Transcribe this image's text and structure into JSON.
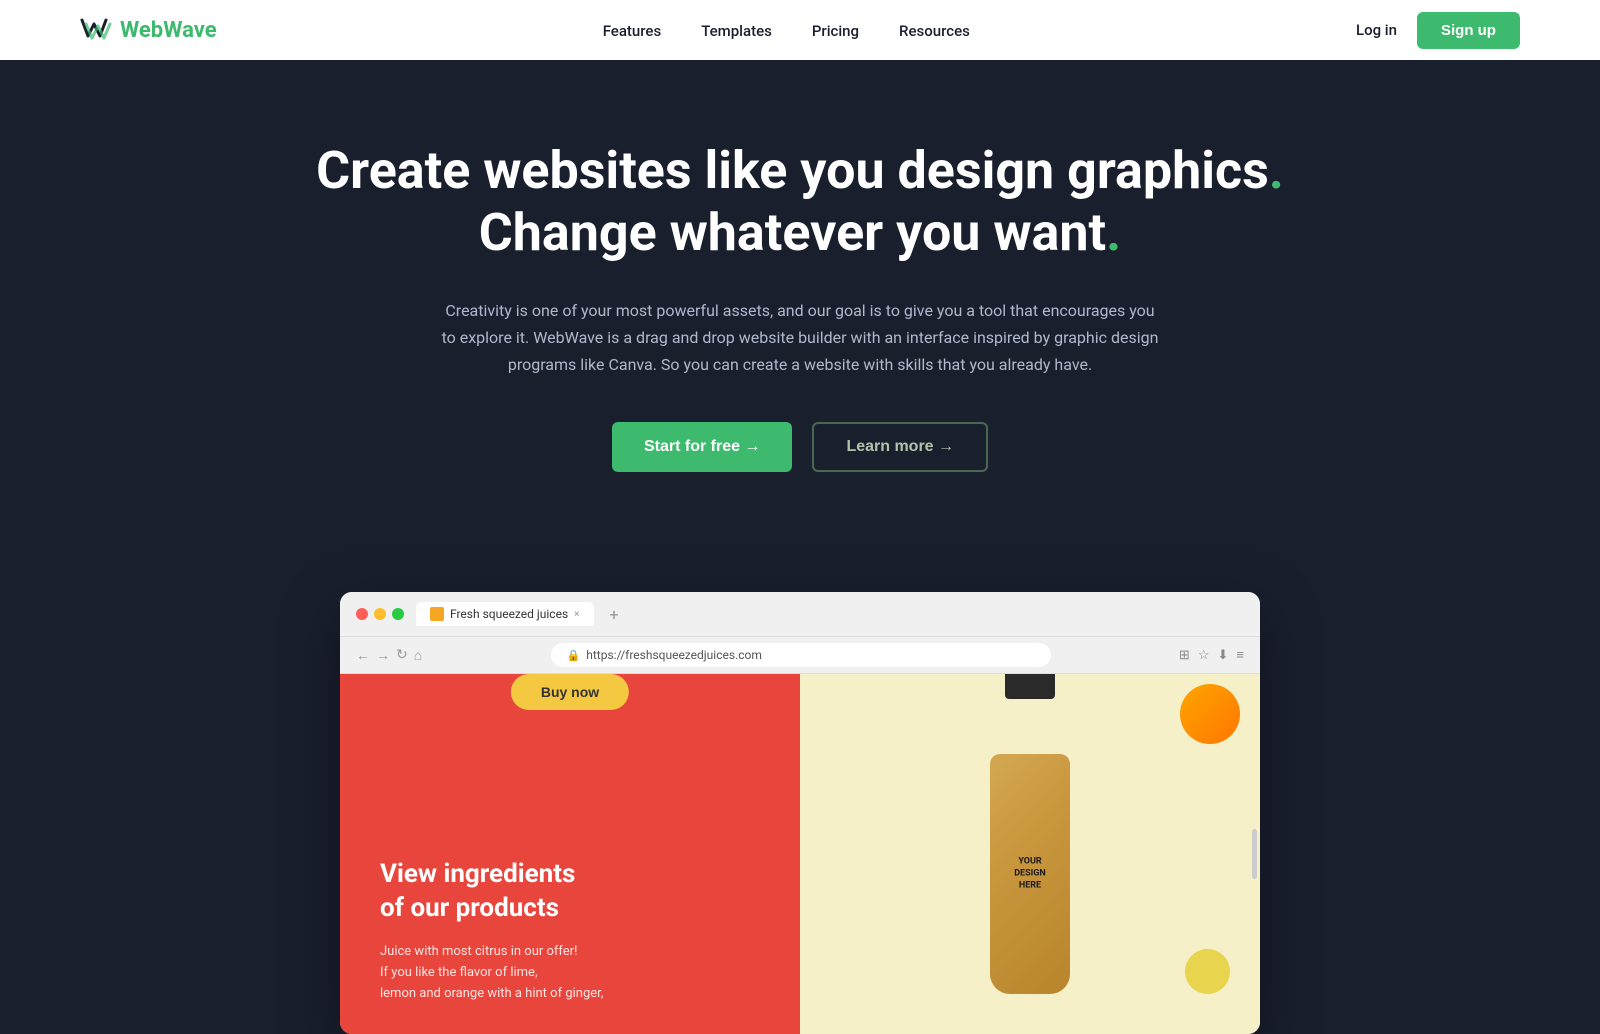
{
  "navbar": {
    "logo_text_plain": "Web",
    "logo_text_accent": "Wave",
    "nav_items": [
      {
        "label": "Features",
        "href": "#"
      },
      {
        "label": "Templates",
        "href": "#"
      },
      {
        "label": "Pricing",
        "href": "#"
      },
      {
        "label": "Resources",
        "href": "#"
      }
    ],
    "login_label": "Log in",
    "signup_label": "Sign up"
  },
  "hero": {
    "title_line1": "Create websites like you design graphics.",
    "title_line2": "Change whatever you want.",
    "subtitle": "Creativity is one of your most powerful assets, and our goal is to give you a tool that encourages you to explore it. WebWave is a drag and drop website builder with an interface inspired by graphic design programs like Canva. So you can create a website with skills that you already have.",
    "cta_primary": "Start for free →",
    "cta_secondary": "Learn more →"
  },
  "browser_mockup": {
    "tab_title": "Fresh squeezed juices",
    "tab_close": "×",
    "tab_add": "+",
    "address_url": "https://freshsqueezedjuices.com",
    "buy_now_label": "Buy now",
    "product_heading_line1": "View ingredients",
    "product_heading_line2": "of our products",
    "product_desc_line1": "Juice with most citrus in our offer!",
    "product_desc_line2": "If you like the flavor of lime,",
    "product_desc_line3": "lemon and orange with a hint of ginger,"
  },
  "colors": {
    "brand_green": "#3dba6e",
    "dark_bg": "#1a1f2e",
    "hero_red": "#e8453c",
    "hero_yellow_bg": "#f5f0c8",
    "bottle_tan": "#d4a853"
  }
}
